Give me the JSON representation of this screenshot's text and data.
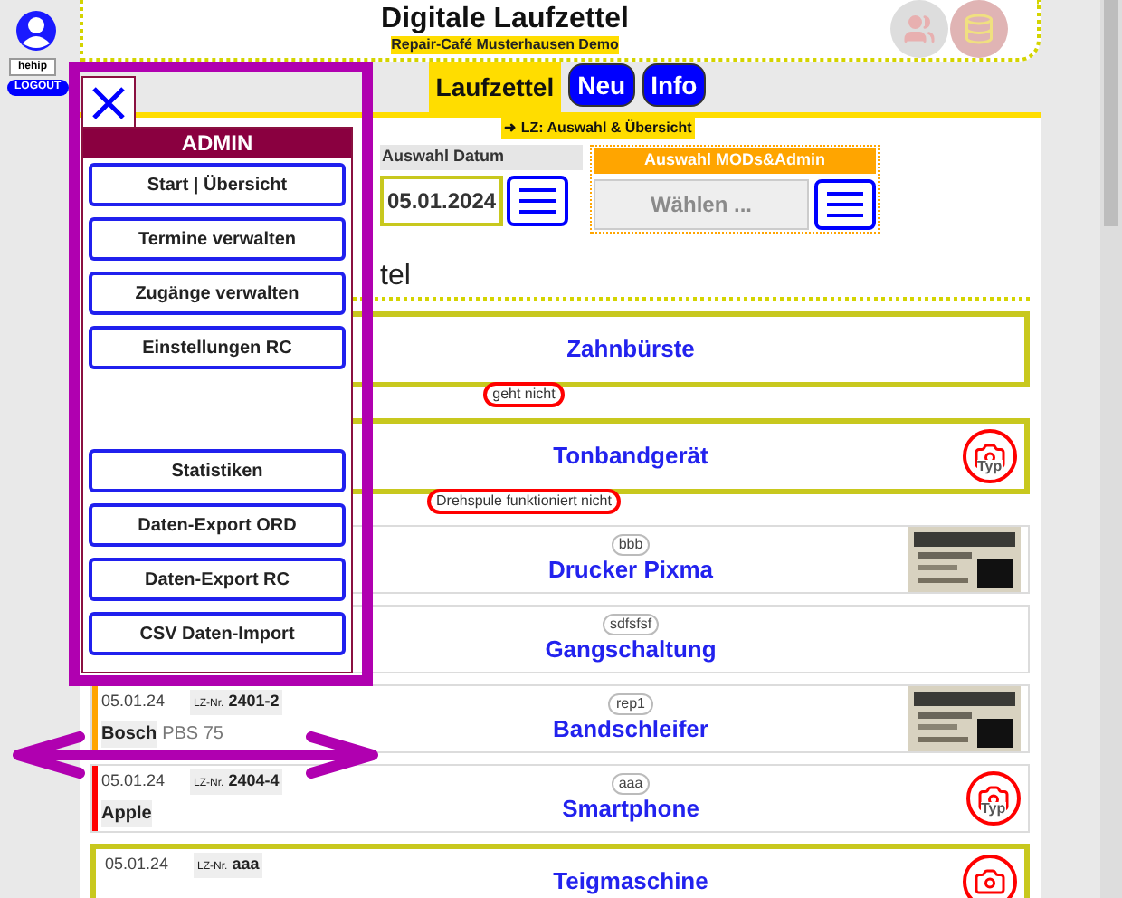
{
  "user": {
    "name": "hehip",
    "logout": "LOGOUT"
  },
  "header": {
    "title": "Digitale Laufzettel",
    "subtitle": "Repair-Café Musterhausen Demo"
  },
  "tabs": [
    {
      "label": "Laufzettel",
      "selected": true
    },
    {
      "label": "Neu",
      "selected": false
    },
    {
      "label": "Info",
      "selected": false
    }
  ],
  "breadcrumb": "➜ LZ: Auswahl & Übersicht",
  "filters": [
    {
      "kind": "date",
      "label": "Auswahl Datum",
      "value": "05.01.2024"
    },
    {
      "kind": "select",
      "label": "Auswahl MODs&Admin",
      "placeholder": "Wählen ..."
    }
  ],
  "list_heading": "tel",
  "items": [
    {
      "name": "Zahnbürste",
      "highlighted": true,
      "note": "geht nicht"
    },
    {
      "name": "Tonbandgerät",
      "highlighted": true,
      "note": "Drehspule funktioniert nicht",
      "photo": {
        "kind": "placeholder",
        "label": "Typ"
      }
    },
    {
      "name": "Drucker Pixma",
      "highlighted": false,
      "tag": "bbb"
    },
    {
      "name": "Gangschaltung",
      "highlighted": false,
      "tag": "sdfsfsf"
    },
    {
      "name": "Bandschleifer",
      "highlighted": false,
      "tag": "rep1",
      "date": "05.01.24",
      "lz_label": "LZ-Nr.",
      "lz": "2401-2",
      "brand": "Bosch",
      "model": "PBS 75",
      "color": "#ffa500"
    },
    {
      "name": "Smartphone",
      "highlighted": false,
      "tag": "aaa",
      "date": "05.01.24",
      "lz_label": "LZ-Nr.",
      "lz": "2404-4",
      "brand": "Apple",
      "color": "#ff0000",
      "photo": {
        "kind": "placeholder",
        "label": "Typ"
      }
    },
    {
      "name": "Teigmaschine",
      "highlighted": true,
      "date": "05.01.24",
      "lz_label": "LZ-Nr.",
      "lz": "aaa",
      "photo": {
        "kind": "placeholder"
      }
    }
  ],
  "admin_menu": {
    "title": "ADMIN",
    "groups": [
      [
        "Start | Übersicht",
        "Termine verwalten",
        "Zugänge verwalten",
        "Einstellungen RC"
      ],
      [
        "Statistiken",
        "Daten-Export ORD",
        "Daten-Export RC",
        "CSV Daten-Import"
      ]
    ]
  }
}
